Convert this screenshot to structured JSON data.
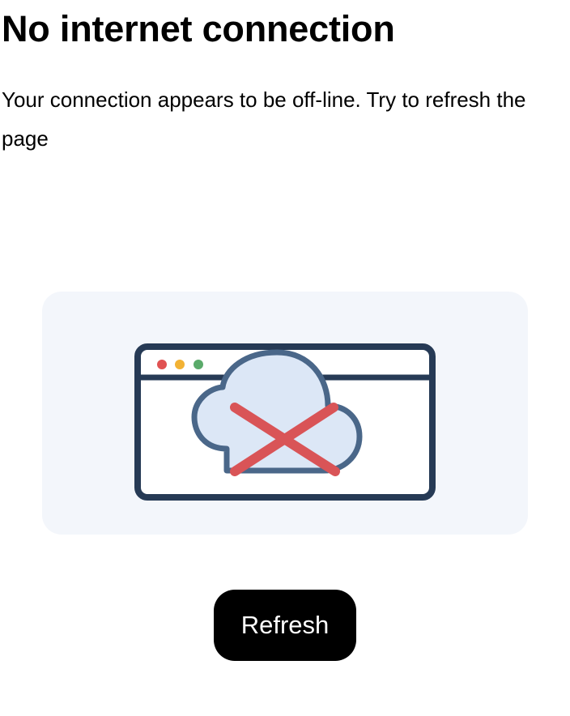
{
  "page": {
    "title": "No internet connection",
    "message": "Your connection appears to be off-line. Try to refresh the page"
  },
  "illustration": {
    "icon": "offline-browser-cloud-icon",
    "colors": {
      "card_background": "#f3f6fb",
      "window_outline": "#263a55",
      "dot_red": "#e05252",
      "dot_yellow": "#f2b234",
      "dot_green": "#5aaa6a",
      "cloud_fill": "#dce7f6",
      "cloud_outline": "#4a6789",
      "cross": "#d95457"
    }
  },
  "actions": {
    "refresh_label": "Refresh"
  }
}
